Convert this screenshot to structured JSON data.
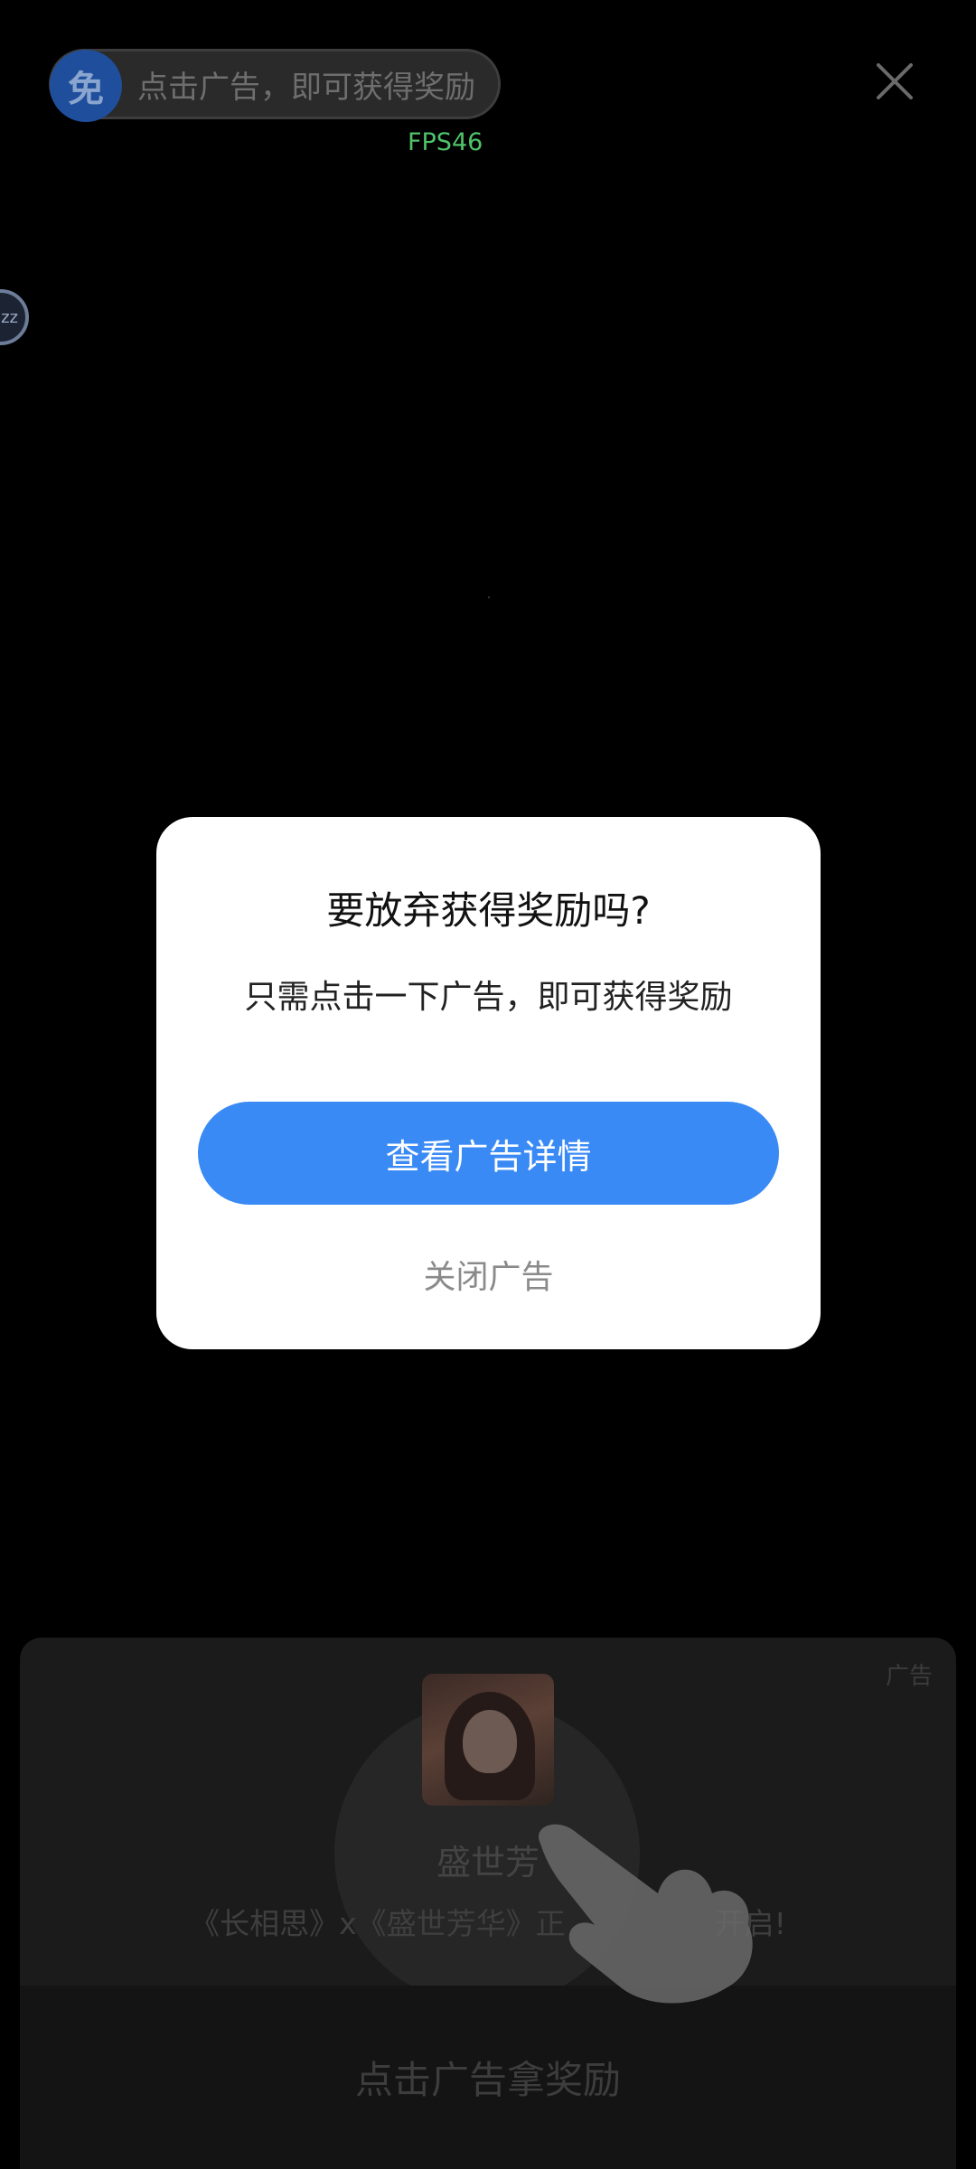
{
  "top_bar": {
    "badge_text": "免",
    "reward_text": "点击广告，即可获得奖励",
    "fps_text": "FPS46",
    "close_icon": "close-icon"
  },
  "floating_bubble": {
    "text": "zz"
  },
  "dialog": {
    "title": "要放弃获得奖励吗?",
    "subtitle": "只需点击一下广告，即可获得奖励",
    "primary_button": "查看广告详情",
    "secondary_button": "关闭广告"
  },
  "ad_card": {
    "ad_tag": "广告",
    "title": "盛世芳",
    "description": "《长相思》x《盛世芳华》正　　　　　开启!",
    "cta": "点击广告拿奖励",
    "hand_icon": "tap-hand-icon"
  },
  "colors": {
    "primary_blue": "#3a8af5",
    "badge_blue": "#1f4f9c",
    "fps_green": "#4fc36a"
  }
}
